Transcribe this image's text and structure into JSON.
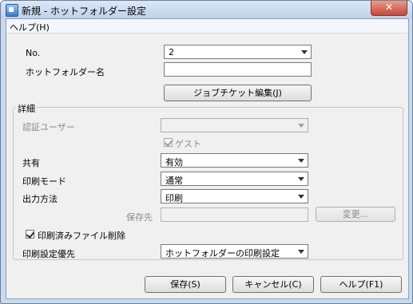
{
  "window": {
    "title": "新規 - ホットフォルダー設定",
    "close_label": "✕"
  },
  "menu": {
    "help": "ヘルプ(H)"
  },
  "form": {
    "no_label": "No.",
    "no_value": "2",
    "hotfolder_name_label": "ホットフォルダー名",
    "hotfolder_name_value": "",
    "jobticket_button": "ジョブチケット編集(J)"
  },
  "details": {
    "group_title": "詳細",
    "auth_user_label": "認証ユーザー",
    "auth_user_value": "",
    "guest_label": "ゲスト",
    "guest_checked": true,
    "share_label": "共有",
    "share_value": "有効",
    "print_mode_label": "印刷モード",
    "print_mode_value": "通常",
    "output_method_label": "出力方法",
    "output_method_value": "印刷",
    "save_dest_label": "保存先",
    "save_dest_value": "",
    "change_button": "変更...",
    "delete_after_print_label": "印刷済みファイル削除",
    "delete_after_print_checked": true
  },
  "print_priority": {
    "label": "印刷設定優先",
    "value": "ホットフォルダーの印刷設定"
  },
  "footer": {
    "save_button": "保存(S)",
    "cancel_button": "キャンセル(C)",
    "help_button": "ヘルプ(F1)"
  }
}
